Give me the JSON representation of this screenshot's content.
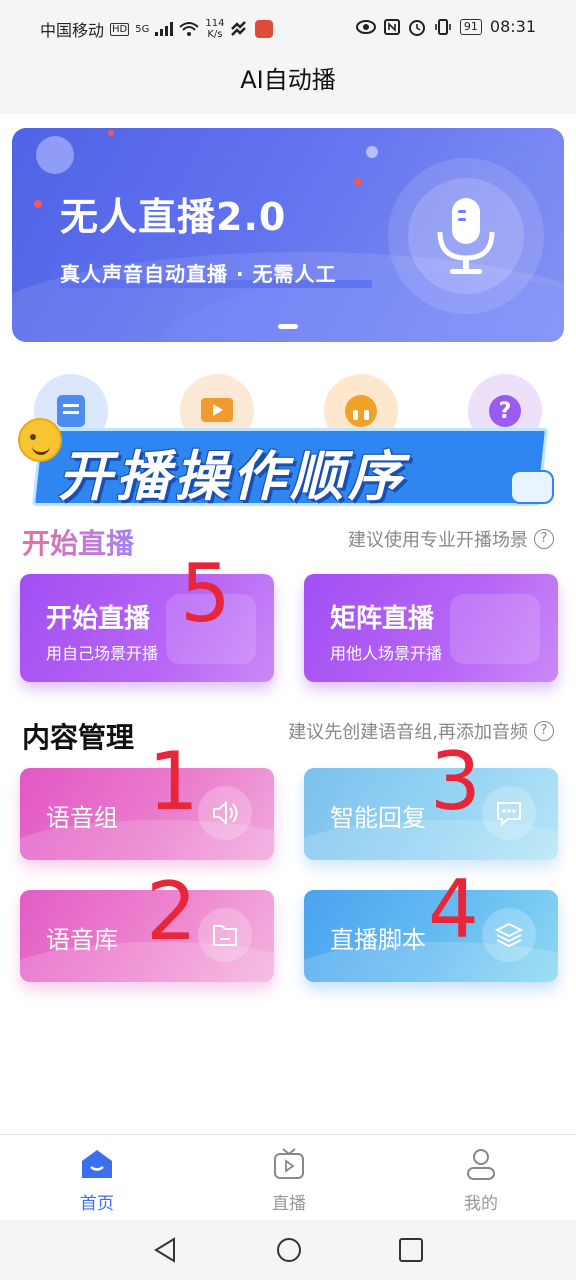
{
  "status_bar": {
    "carrier": "中国移动",
    "hd": "HD",
    "network": "5G",
    "speed_value": "114",
    "speed_unit": "K/s",
    "battery": "91",
    "time": "08:31"
  },
  "header": {
    "title": "AI自动播"
  },
  "banner": {
    "title": "无人直播2.0",
    "subtitle": "真人声音自动直播 · 无需人工",
    "icon": "microphone-icon"
  },
  "quick_icons": [
    "document-icon",
    "play-icon",
    "headphones-icon",
    "question-icon"
  ],
  "overlay": {
    "text": "开播操作顺序"
  },
  "live_section": {
    "title": "开始直播",
    "hint": "建议使用专业开播场景",
    "cards": [
      {
        "title": "开始直播",
        "subtitle": "用自己场景开播"
      },
      {
        "title": "矩阵直播",
        "subtitle": "用他人场景开播"
      }
    ]
  },
  "content_section": {
    "title": "内容管理",
    "hint": "建议先创建语音组,再添加音频",
    "cards": [
      {
        "label": "语音组",
        "icon": "speaker-icon"
      },
      {
        "label": "智能回复",
        "icon": "chat-icon"
      },
      {
        "label": "语音库",
        "icon": "folder-icon"
      },
      {
        "label": "直播脚本",
        "icon": "layers-icon"
      }
    ]
  },
  "annotations": [
    "5",
    "1",
    "3",
    "2",
    "4"
  ],
  "tabbar": {
    "items": [
      {
        "label": "首页",
        "active": true
      },
      {
        "label": "直播",
        "active": false
      },
      {
        "label": "我的",
        "active": false
      }
    ]
  },
  "colors": {
    "accent": "#3c6ff0",
    "annotation": "#e8263a",
    "banner": "#5a6cea"
  }
}
